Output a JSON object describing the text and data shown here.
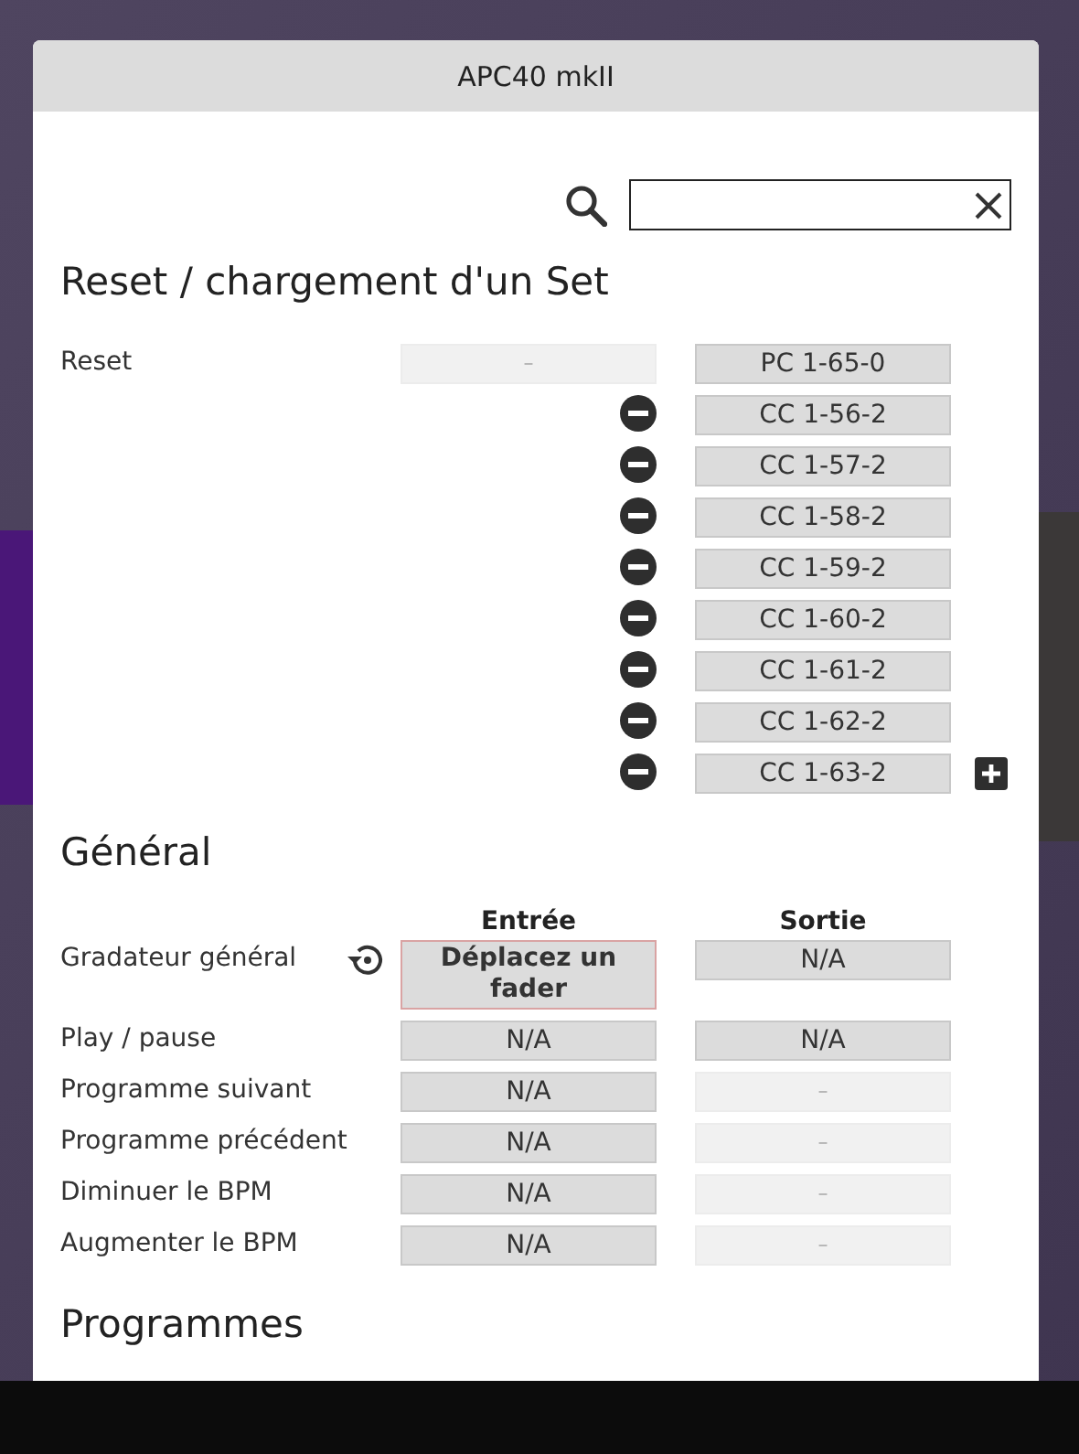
{
  "window": {
    "title": "APC40 mkII"
  },
  "sections": [
    {
      "title": "Reset / chargement d'un Set",
      "rows": [
        {
          "label": "Reset",
          "input": {
            "text": "–",
            "kind": "empty"
          },
          "output": {
            "text": "PC 1-65-0",
            "kind": "value"
          }
        },
        {
          "remove": true,
          "output": {
            "text": "CC 1-56-2",
            "kind": "value"
          }
        },
        {
          "remove": true,
          "output": {
            "text": "CC 1-57-2",
            "kind": "value"
          }
        },
        {
          "remove": true,
          "output": {
            "text": "CC 1-58-2",
            "kind": "value"
          }
        },
        {
          "remove": true,
          "output": {
            "text": "CC 1-59-2",
            "kind": "value"
          }
        },
        {
          "remove": true,
          "output": {
            "text": "CC 1-60-2",
            "kind": "value"
          }
        },
        {
          "remove": true,
          "output": {
            "text": "CC 1-61-2",
            "kind": "value"
          }
        },
        {
          "remove": true,
          "output": {
            "text": "CC 1-62-2",
            "kind": "value"
          }
        },
        {
          "remove": true,
          "add": true,
          "output": {
            "text": "CC 1-63-2",
            "kind": "value"
          }
        }
      ]
    },
    {
      "title": "Général",
      "columns": [
        "Entrée",
        "Sortie"
      ],
      "rows": [
        {
          "label": "Gradateur général",
          "reset": true,
          "input": {
            "text": "Déplacez un fader",
            "kind": "learning"
          },
          "output": {
            "text": "N/A",
            "kind": "value"
          }
        },
        {
          "label": "Play / pause",
          "input": {
            "text": "N/A",
            "kind": "value"
          },
          "output": {
            "text": "N/A",
            "kind": "value"
          }
        },
        {
          "label": "Programme suivant",
          "input": {
            "text": "N/A",
            "kind": "value"
          },
          "output": {
            "text": "–",
            "kind": "empty"
          }
        },
        {
          "label": "Programme précédent",
          "input": {
            "text": "N/A",
            "kind": "value"
          },
          "output": {
            "text": "–",
            "kind": "empty"
          }
        },
        {
          "label": "Diminuer le BPM",
          "input": {
            "text": "N/A",
            "kind": "value"
          },
          "output": {
            "text": "–",
            "kind": "empty"
          }
        },
        {
          "label": "Augmenter le BPM",
          "input": {
            "text": "N/A",
            "kind": "value"
          },
          "output": {
            "text": "–",
            "kind": "empty"
          }
        }
      ]
    },
    {
      "title": "Programmes"
    }
  ]
}
